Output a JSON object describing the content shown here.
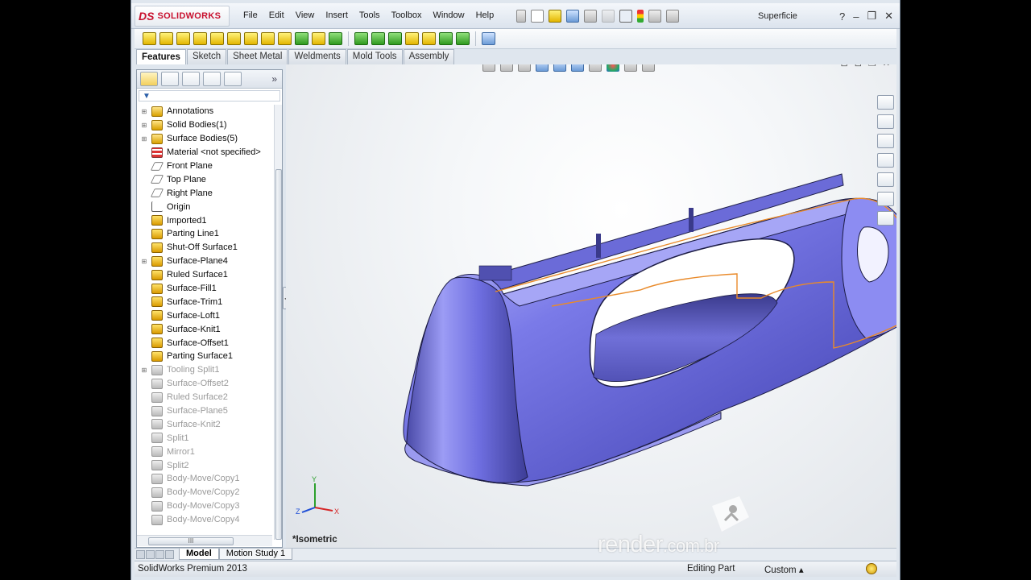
{
  "app": {
    "brand_ds": "DS",
    "brand_name": "SOLIDWORKS",
    "document_title": "Superficie"
  },
  "menu": [
    "File",
    "Edit",
    "View",
    "Insert",
    "Tools",
    "Toolbox",
    "Window",
    "Help"
  ],
  "tabs": [
    {
      "label": "Features",
      "active": true
    },
    {
      "label": "Sketch",
      "active": false
    },
    {
      "label": "Sheet Metal",
      "active": false
    },
    {
      "label": "Weldments",
      "active": false
    },
    {
      "label": "Mold Tools",
      "active": false
    },
    {
      "label": "Assembly",
      "active": false
    }
  ],
  "feature_tree": [
    {
      "label": "Annotations",
      "icon": "annotations-icon",
      "expandable": true,
      "dim": false
    },
    {
      "label": "Solid Bodies(1)",
      "icon": "solid-bodies-icon",
      "expandable": true,
      "dim": false
    },
    {
      "label": "Surface Bodies(5)",
      "icon": "surface-bodies-icon",
      "expandable": true,
      "dim": false
    },
    {
      "label": "Material <not specified>",
      "icon": "material-icon",
      "expandable": false,
      "dim": false
    },
    {
      "label": "Front Plane",
      "icon": "plane-icon",
      "expandable": false,
      "dim": false
    },
    {
      "label": "Top Plane",
      "icon": "plane-icon",
      "expandable": false,
      "dim": false
    },
    {
      "label": "Right Plane",
      "icon": "plane-icon",
      "expandable": false,
      "dim": false
    },
    {
      "label": "Origin",
      "icon": "origin-icon",
      "expandable": false,
      "dim": false
    },
    {
      "label": "Imported1",
      "icon": "imported-icon",
      "expandable": false,
      "dim": false
    },
    {
      "label": "Parting Line1",
      "icon": "parting-line-icon",
      "expandable": false,
      "dim": false
    },
    {
      "label": "Shut-Off Surface1",
      "icon": "shut-off-surface-icon",
      "expandable": false,
      "dim": false
    },
    {
      "label": "Surface-Plane4",
      "icon": "surface-plane-icon",
      "expandable": true,
      "dim": false
    },
    {
      "label": "Ruled Surface1",
      "icon": "ruled-surface-icon",
      "expandable": false,
      "dim": false
    },
    {
      "label": "Surface-Fill1",
      "icon": "surface-fill-icon",
      "expandable": false,
      "dim": false
    },
    {
      "label": "Surface-Trim1",
      "icon": "surface-trim-icon",
      "expandable": false,
      "dim": false
    },
    {
      "label": "Surface-Loft1",
      "icon": "surface-loft-icon",
      "expandable": false,
      "dim": false
    },
    {
      "label": "Surface-Knit1",
      "icon": "surface-knit-icon",
      "expandable": false,
      "dim": false
    },
    {
      "label": "Surface-Offset1",
      "icon": "surface-offset-icon",
      "expandable": false,
      "dim": false
    },
    {
      "label": "Parting Surface1",
      "icon": "parting-surface-icon",
      "expandable": false,
      "dim": false
    },
    {
      "label": "Tooling Split1",
      "icon": "tooling-split-icon",
      "expandable": true,
      "dim": true
    },
    {
      "label": "Surface-Offset2",
      "icon": "surface-offset-icon",
      "expandable": false,
      "dim": true
    },
    {
      "label": "Ruled Surface2",
      "icon": "ruled-surface-icon",
      "expandable": false,
      "dim": true
    },
    {
      "label": "Surface-Plane5",
      "icon": "surface-plane-icon",
      "expandable": false,
      "dim": true
    },
    {
      "label": "Surface-Knit2",
      "icon": "surface-knit-icon",
      "expandable": false,
      "dim": true
    },
    {
      "label": "Split1",
      "icon": "split-icon",
      "expandable": false,
      "dim": true
    },
    {
      "label": "Mirror1",
      "icon": "mirror-icon",
      "expandable": false,
      "dim": true
    },
    {
      "label": "Split2",
      "icon": "split-icon",
      "expandable": false,
      "dim": true
    },
    {
      "label": "Body-Move/Copy1",
      "icon": "body-move-icon",
      "expandable": false,
      "dim": true
    },
    {
      "label": "Body-Move/Copy2",
      "icon": "body-move-icon",
      "expandable": false,
      "dim": true
    },
    {
      "label": "Body-Move/Copy3",
      "icon": "body-move-icon",
      "expandable": false,
      "dim": true
    },
    {
      "label": "Body-Move/Copy4",
      "icon": "body-move-icon",
      "expandable": false,
      "dim": true
    }
  ],
  "viewport": {
    "view_label": "*Isometric",
    "triad": {
      "x": "X",
      "y": "Y",
      "z": "Z"
    },
    "model_fill": "#7f7ff0",
    "edge_highlight": "#e98a2a"
  },
  "bottom_tabs": [
    {
      "label": "Model",
      "active": true
    },
    {
      "label": "Motion Study 1",
      "active": false
    }
  ],
  "status": {
    "product": "SolidWorks Premium 2013",
    "mode": "Editing Part",
    "units": "Custom"
  },
  "watermark": {
    "main": "render",
    "suffix": ".com.br"
  }
}
